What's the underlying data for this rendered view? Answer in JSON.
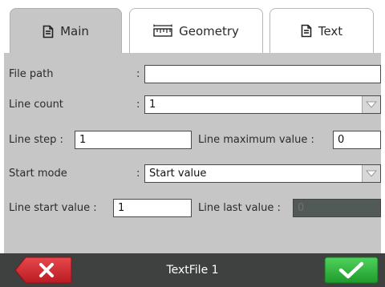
{
  "tabs": [
    {
      "label": "Main",
      "icon": "document-icon",
      "active": true
    },
    {
      "label": "Geometry",
      "icon": "ruler-icon",
      "active": false
    },
    {
      "label": "Text",
      "icon": "document-icon",
      "active": false
    }
  ],
  "form": {
    "file_path": {
      "label": "File path",
      "colon": ":",
      "value": ""
    },
    "line_count": {
      "label": "Line count",
      "colon": ":",
      "value": "1"
    },
    "line_step": {
      "label": "Line step :",
      "value": "1"
    },
    "line_max": {
      "label": "Line maximum value :",
      "value": "0"
    },
    "start_mode": {
      "label": "Start mode",
      "colon": ":",
      "value": "Start value"
    },
    "line_start": {
      "label": "Line start value :",
      "value": "1"
    },
    "line_last": {
      "label": "Line last value :",
      "value": "0"
    }
  },
  "footer": {
    "title": "TextFile 1"
  },
  "colors": {
    "panel": "#c6c6c6",
    "footer": "#3f4040",
    "cancel": "#d2252b",
    "ok": "#2ebc3e"
  }
}
